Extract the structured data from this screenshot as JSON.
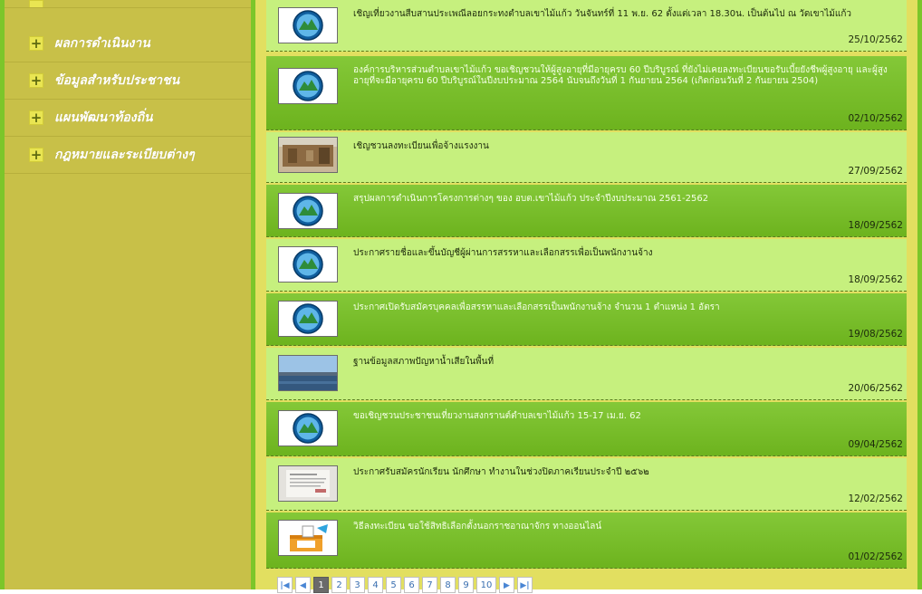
{
  "sidebar": {
    "items": [
      {
        "label": "ผลการดำเนินงาน"
      },
      {
        "label": "ข้อมูลสำหรับประชาชน"
      },
      {
        "label": "แผนพัฒนาท้องถิ่น"
      },
      {
        "label": "กฎหมายและระเบียบต่างๆ"
      }
    ],
    "plus_symbol": "+"
  },
  "news": [
    {
      "title": "เชิญเที่ยวงานสืบสานประเพณีลอยกระทงตำบลเขาไม้แก้ว วันจันทร์ที่ 11 พ.ย. 62 ตั้งแต่เวลา 18.30น. เป็นต้นไป ณ วัดเขาไม้แก้ว",
      "date": "25/10/2562",
      "thumb": "logo-seal"
    },
    {
      "title": "องค์การบริหารส่วนตำบลเขาไม้แก้ว ขอเชิญชวนให้ผู้สูงอายุที่มีอายุครบ 60 ปีบริบูรณ์ ที่ยังไม่เคยลงทะเบียนขอรับเบี้ยยังชีพผู้สูงอายุ และผู้สูงอายุที่จะมีอายุครบ 60 ปีบริบูรณ์ในปีงบประมาณ 2564 นับจนถึงวันที่ 1 กันยายน 2564 (เกิดก่อนวันที่ 2 กันยายน 2504)",
      "date": "02/10/2562",
      "thumb": "logo-seal"
    },
    {
      "title": "เชิญชวนลงทะเบียนเพื่อจ้างแรงงาน",
      "date": "27/09/2562",
      "thumb": "construction-photo"
    },
    {
      "title": "สรุปผลการดำเนินการโครงการต่างๆ ของ อบต.เขาไม้แก้ว ประจำปีงบประมาณ 2561-2562",
      "date": "18/09/2562",
      "thumb": "logo-seal"
    },
    {
      "title": "ประกาศรายชื่อและขึ้นบัญชีผู้ผ่านการสรรหาและเลือกสรรเพื่อเป็นพนักงานจ้าง",
      "date": "18/09/2562",
      "thumb": "logo-seal"
    },
    {
      "title": "ประกาศเปิดรับสมัครบุคคลเพื่อสรรหาและเลือกสรรเป็นพนักงานจ้าง จำนวน 1 ตำแหน่ง 1 อัตรา",
      "date": "19/08/2562",
      "thumb": "logo-seal"
    },
    {
      "title": "ฐานข้อมูลสภาพปัญหาน้ำเสียในพื้นที่",
      "date": "20/06/2562",
      "thumb": "water-photo"
    },
    {
      "title": "ขอเชิญชวนประชาชนเที่ยวงานสงกรานต์ตำบลเขาไม้แก้ว 15-17 เม.ย. 62",
      "date": "09/04/2562",
      "thumb": "logo-seal"
    },
    {
      "title": "ประกาศรับสมัครนักเรียน นักศึกษา ทำงานในช่วงปิดภาคเรียนประจำปี ๒๕๖๒",
      "date": "12/02/2562",
      "thumb": "document-photo"
    },
    {
      "title": "วิธีลงทะเบียน ขอใช้สิทธิเลือกตั้งนอกราชอาณาจักร ทางออนไลน์",
      "date": "01/02/2562",
      "thumb": "ballot-box-illustration"
    }
  ],
  "pagination": {
    "pages": [
      "1",
      "2",
      "3",
      "4",
      "5",
      "6",
      "7",
      "8",
      "9",
      "10"
    ],
    "current": "1",
    "first_icon": "first-page-icon",
    "prev_icon": "prev-page-icon",
    "next_icon": "next-page-icon",
    "last_icon": "last-page-icon"
  },
  "colors": {
    "sidebar": "#c8c048",
    "accent_green": "#7cc62a",
    "row_light": "#c6f07e",
    "row_dark": "#6db31e",
    "frame_yellow": "#e2df60"
  }
}
